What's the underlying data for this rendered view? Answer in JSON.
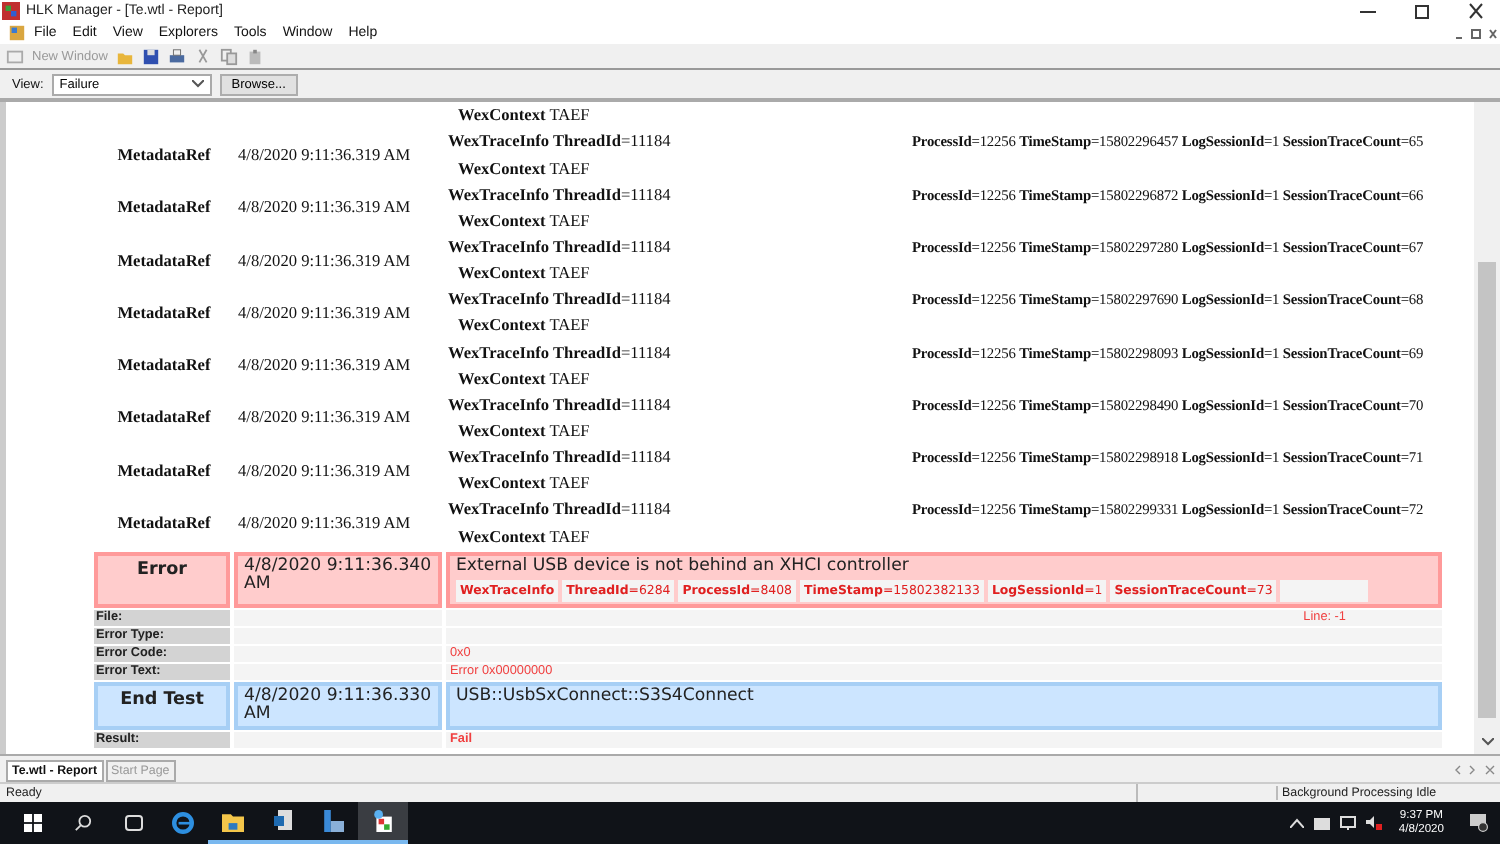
{
  "window": {
    "title": "HLK Manager - [Te.wtl - Report]"
  },
  "menu": [
    "File",
    "Edit",
    "View",
    "Explorers",
    "Tools",
    "Window",
    "Help"
  ],
  "toolbar": {
    "new_window": "New Window",
    "new_window_disabled": true
  },
  "view_bar": {
    "label": "View:",
    "value": "Failure",
    "browse": "Browse..."
  },
  "log": {
    "partial_entry": {
      "context": "**WexContext** TAEF"
    },
    "entries": [
      {
        "label": "MetadataRef",
        "time": "4/8/2020 9:11:36.319 AM",
        "thread": "**WexTraceInfo ThreadId**=11184",
        "trace": "**ProcessId**=12256 **TimeStamp**=15802296457 **LogSessionId**=1 **SessionTraceCount**=65",
        "context": "**WexContext** TAEF"
      },
      {
        "label": "MetadataRef",
        "time": "4/8/2020 9:11:36.319 AM",
        "thread": "**WexTraceInfo ThreadId**=11184",
        "trace": "**ProcessId**=12256 **TimeStamp**=15802296872 **LogSessionId**=1 **SessionTraceCount**=66",
        "context": "**WexContext** TAEF"
      },
      {
        "label": "MetadataRef",
        "time": "4/8/2020 9:11:36.319 AM",
        "thread": "**WexTraceInfo ThreadId**=11184",
        "trace": "**ProcessId**=12256 **TimeStamp**=15802297280 **LogSessionId**=1 **SessionTraceCount**=67",
        "context": "**WexContext** TAEF"
      },
      {
        "label": "MetadataRef",
        "time": "4/8/2020 9:11:36.319 AM",
        "thread": "**WexTraceInfo ThreadId**=11184",
        "trace": "**ProcessId**=12256 **TimeStamp**=15802297690 **LogSessionId**=1 **SessionTraceCount**=68",
        "context": "**WexContext** TAEF"
      },
      {
        "label": "MetadataRef",
        "time": "4/8/2020 9:11:36.319 AM",
        "thread": "**WexTraceInfo ThreadId**=11184",
        "trace": "**ProcessId**=12256 **TimeStamp**=15802298093 **LogSessionId**=1 **SessionTraceCount**=69",
        "context": "**WexContext** TAEF"
      },
      {
        "label": "MetadataRef",
        "time": "4/8/2020 9:11:36.319 AM",
        "thread": "**WexTraceInfo ThreadId**=11184",
        "trace": "**ProcessId**=12256 **TimeStamp**=15802298490 **LogSessionId**=1 **SessionTraceCount**=70",
        "context": "**WexContext** TAEF"
      },
      {
        "label": "MetadataRef",
        "time": "4/8/2020 9:11:36.319 AM",
        "thread": "**WexTraceInfo ThreadId**=11184",
        "trace": "**ProcessId**=12256 **TimeStamp**=15802298918 **LogSessionId**=1 **SessionTraceCount**=71",
        "context": "**WexContext** TAEF"
      },
      {
        "label": "MetadataRef",
        "time": "4/8/2020 9:11:36.319 AM",
        "thread": "**WexTraceInfo ThreadId**=11184",
        "trace": "**ProcessId**=12256 **TimeStamp**=15802299331 **LogSessionId**=1 **SessionTraceCount**=72",
        "context": "**WexContext** TAEF"
      }
    ]
  },
  "events": [
    {
      "kind": "error",
      "status": "Error",
      "time": "4/8/2020 9:11:36.340 AM",
      "message": "External USB device is not behind an XHCI controller",
      "trace": [
        "**WexTraceInfo**",
        "**ThreadId**=6284",
        "**ProcessId**=8408",
        "**TimeStamp**=15802382133",
        "**LogSessionId**=1",
        "**SessionTraceCount**=73"
      ],
      "details": [
        {
          "label": "File:",
          "extra": "Line: -1"
        },
        {
          "label": "Error Type:"
        },
        {
          "label": "Error Code:",
          "value": "0x0"
        },
        {
          "label": "Error Text:",
          "value": "Error 0x00000000"
        }
      ]
    },
    {
      "kind": "end",
      "status": "End Test",
      "time": "4/8/2020 9:11:36.330 AM",
      "message": "USB::UsbSxConnect::S3S4Connect",
      "details": [
        {
          "label": "Result:",
          "value": "Fail",
          "strong": true
        }
      ]
    }
  ],
  "tabs": [
    {
      "label": "Te.wtl - Report",
      "selected": true
    },
    {
      "label": "Start Page",
      "selected": false
    }
  ],
  "status_bar": {
    "left": "Ready",
    "right": "Background Processing Idle"
  },
  "taskbar": {
    "time": "9:37 PM",
    "date": "4/8/2020"
  }
}
